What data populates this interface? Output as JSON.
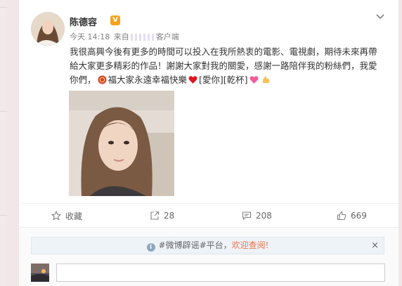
{
  "post": {
    "username": "陈德容",
    "vip_badge": "V",
    "time": "今天 14:18",
    "source_prefix": "来自",
    "source_suffix": "客户端",
    "lines": [
      "我很高興今後有更多的時間可以投入在我所熱衷的電影、電視劇，期待未來再帶",
      "給大家更多精彩的作品！謝謝大家對我的關愛，感謝一路陪伴我的粉絲們，我愛",
      "你們，"
    ],
    "line3_text": "福大家永遠幸福快樂",
    "tags": "[愛你][乾杯]"
  },
  "actions": {
    "favorite_label": "收藏",
    "repost_count": "28",
    "comment_count": "208",
    "like_count": "669"
  },
  "notice": {
    "text": "#微博辟谣#平台，",
    "link": "欢迎查阅!",
    "close": "×"
  },
  "icons": {
    "more": "chevron-down-icon",
    "favorite": "star-icon",
    "repost": "share-icon",
    "comment": "comment-icon",
    "like": "thumbs-up-icon",
    "info": "info-icon"
  },
  "colors": {
    "accent": "#eb7350",
    "vip": "#f7a21b"
  }
}
